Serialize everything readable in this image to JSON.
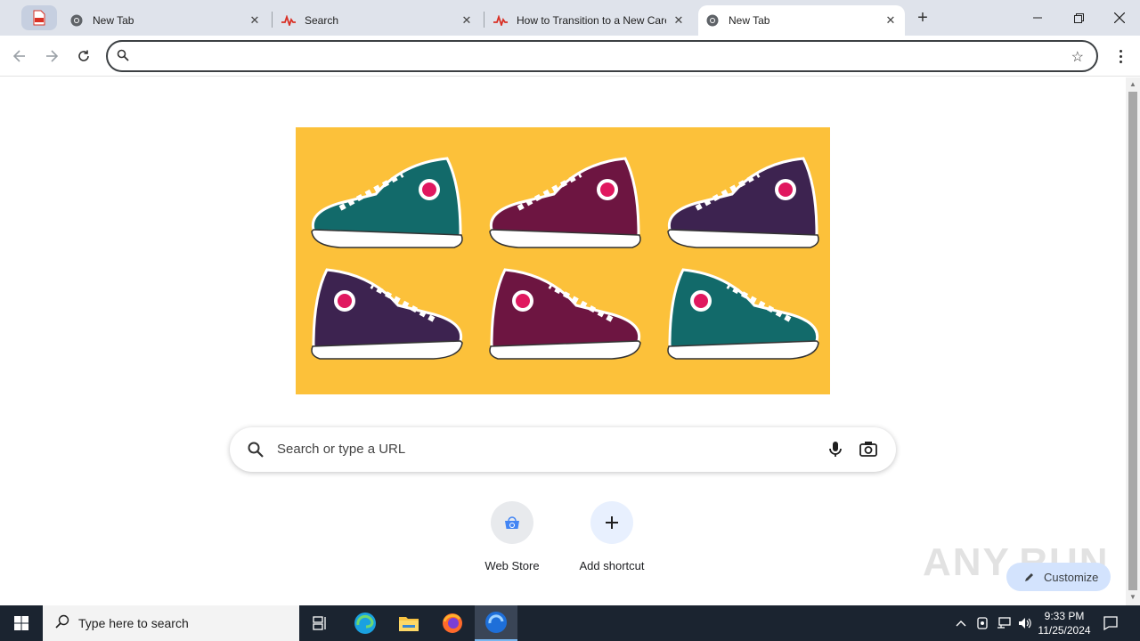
{
  "tabs": [
    {
      "label": "New Tab",
      "icon": "chrome-icon"
    },
    {
      "label": "Search",
      "icon": "anyrun-icon"
    },
    {
      "label": "How to Transition to a New Career",
      "icon": "anyrun-icon"
    },
    {
      "label": "New Tab",
      "icon": "chrome-icon",
      "active": true
    }
  ],
  "omnibox": {
    "value": "",
    "placeholder": ""
  },
  "search": {
    "placeholder": "Search or type a URL"
  },
  "shortcuts": [
    {
      "label": "Web Store",
      "icon": "web-store-icon"
    },
    {
      "label": "Add shortcut",
      "icon": "plus-icon"
    }
  ],
  "customize": {
    "label": "Customize"
  },
  "watermark": {
    "text": "ANY.RUN"
  },
  "taskbar": {
    "search_placeholder": "Type here to search",
    "time": "9:33 PM",
    "date": "11/25/2024"
  },
  "colors": {
    "tabstrip": "#dfe3eb",
    "doodle_bg": "#fcc13a",
    "accent": "#0b57d0",
    "taskbar": "#1b2430"
  }
}
